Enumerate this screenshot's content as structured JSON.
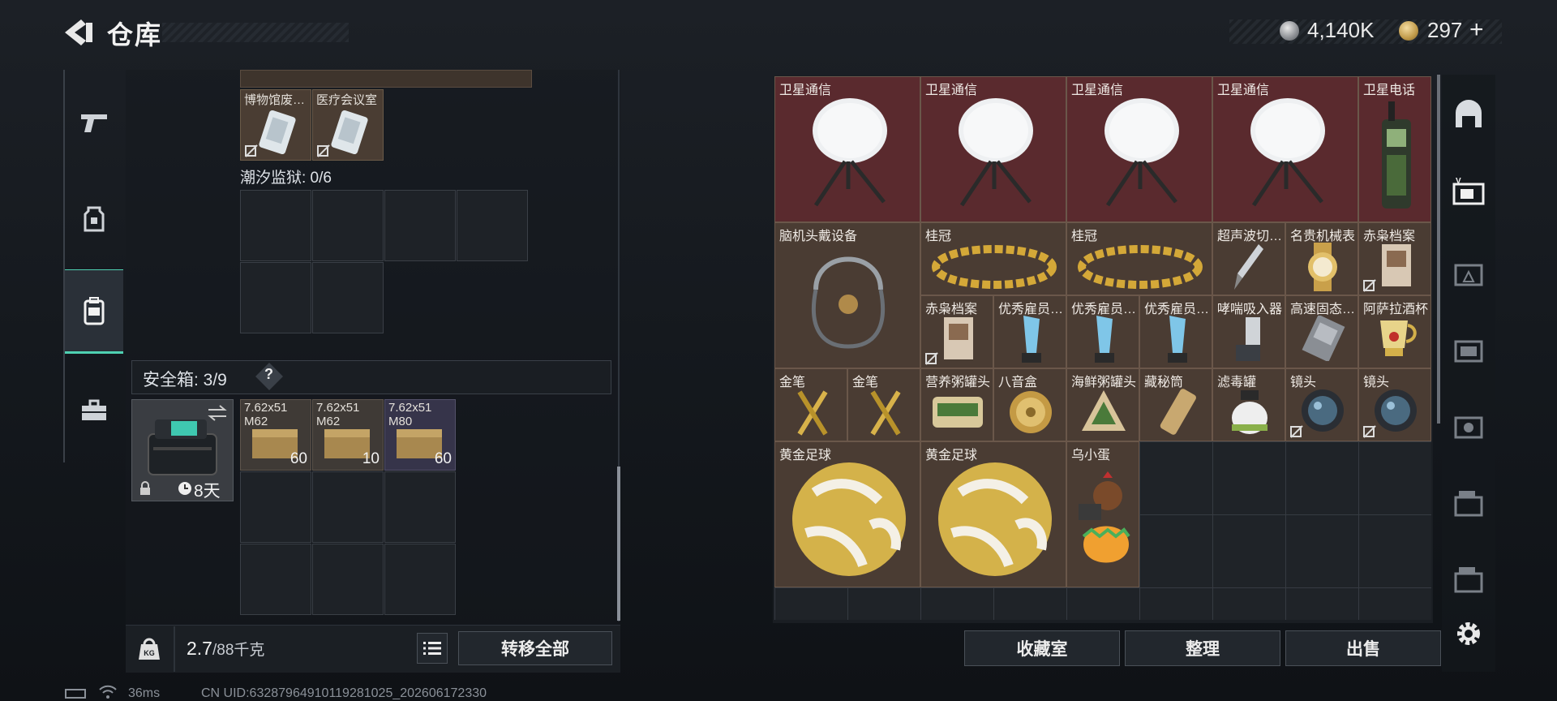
{
  "header": {
    "title": "仓库"
  },
  "currency": {
    "silver": "4,140K",
    "gold": "297",
    "gold_plus": "+"
  },
  "left_rail": {
    "tabs": [
      {
        "name": "weapons"
      },
      {
        "name": "equipment"
      },
      {
        "name": "backpack",
        "active": true
      },
      {
        "name": "toolbox"
      }
    ]
  },
  "stash": {
    "top_items": [
      {
        "label": "博物馆废…",
        "linked": false
      },
      {
        "label": "医疗会议室",
        "linked": false
      }
    ],
    "tide_prison": {
      "label": "潮汐监狱: 0/6"
    },
    "safe_box": {
      "label": "安全箱: 3/9",
      "help": "?",
      "timer": "8天",
      "ammo": [
        {
          "line1": "7.62x51",
          "line2": "M62",
          "qty": "60"
        },
        {
          "line1": "7.62x51",
          "line2": "M62",
          "qty": "10"
        },
        {
          "line1": "7.62x51",
          "line2": "M80",
          "qty": "60"
        }
      ]
    },
    "weight": {
      "value": "2.7",
      "capacity": "/88千克"
    },
    "transfer_all": "转移全部"
  },
  "inventory": {
    "items": [
      {
        "label": "卫星通信",
        "color": "red"
      },
      {
        "label": "卫星通信",
        "color": "red"
      },
      {
        "label": "卫星通信",
        "color": "red"
      },
      {
        "label": "卫星通信",
        "color": "red"
      },
      {
        "label": "卫星电话",
        "color": "red"
      },
      {
        "label": "脑机头戴设备",
        "color": "brown"
      },
      {
        "label": "桂冠",
        "color": "brown"
      },
      {
        "label": "桂冠",
        "color": "brown"
      },
      {
        "label": "超声波切…",
        "color": "brown"
      },
      {
        "label": "名贵机械表",
        "color": "brown"
      },
      {
        "label": "赤枭档案",
        "color": "brown"
      },
      {
        "label": "赤枭档案",
        "color": "brown"
      },
      {
        "label": "优秀雇员…",
        "color": "brown"
      },
      {
        "label": "优秀雇员…",
        "color": "brown"
      },
      {
        "label": "优秀雇员…",
        "color": "brown"
      },
      {
        "label": "哮喘吸入器",
        "color": "brown"
      },
      {
        "label": "高速固态…",
        "color": "brown"
      },
      {
        "label": "阿萨拉酒杯",
        "color": "brown"
      },
      {
        "label": "金笔",
        "color": "brown"
      },
      {
        "label": "金笔",
        "color": "brown"
      },
      {
        "label": "营养粥罐头",
        "color": "brown"
      },
      {
        "label": "八音盒",
        "color": "brown"
      },
      {
        "label": "海鲜粥罐头",
        "color": "brown"
      },
      {
        "label": "藏秘筒",
        "color": "brown"
      },
      {
        "label": "滤毒罐",
        "color": "brown"
      },
      {
        "label": "镜头",
        "color": "brown"
      },
      {
        "label": "镜头",
        "color": "brown"
      },
      {
        "label": "黄金足球",
        "color": "brown"
      },
      {
        "label": "黄金足球",
        "color": "brown"
      },
      {
        "label": "乌小蛋",
        "color": "brown"
      }
    ],
    "buttons": {
      "collection": "收藏室",
      "organize": "整理",
      "sell": "出售"
    }
  },
  "status_bar": {
    "ping": "36ms",
    "uid": "CN UID:632879649101192810​25_202606172330"
  }
}
